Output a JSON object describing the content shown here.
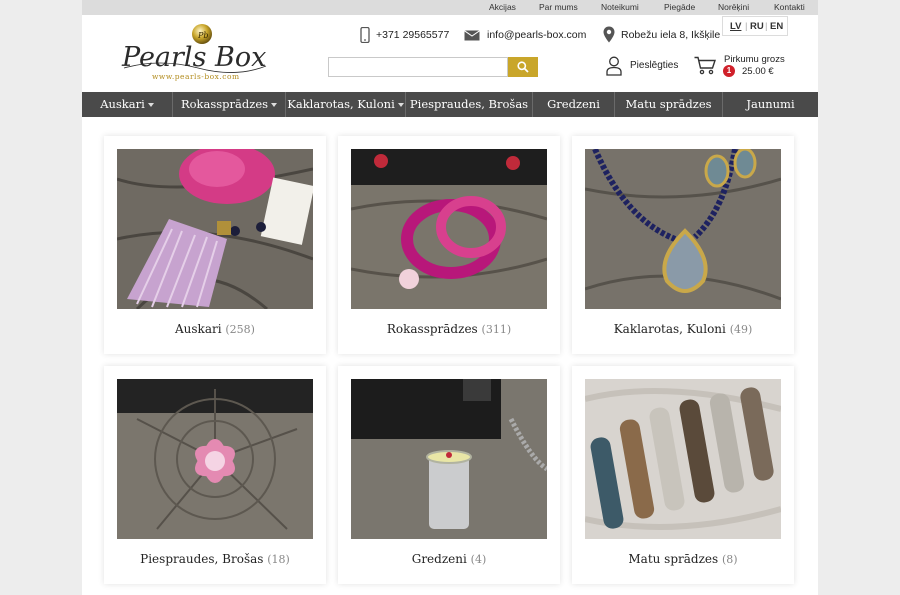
{
  "topbar": {
    "links": [
      "Akcijas",
      "Par mums",
      "Noteikumi",
      "Piegāde",
      "Norēķini",
      "Kontakti"
    ]
  },
  "logo": {
    "text": "Pearls Box",
    "url_text": "www.pearls-box.com"
  },
  "contact": {
    "phone": "+371 29565577",
    "email": "info@pearls-box.com",
    "address": "Robežu iela 8, Ikšķile"
  },
  "languages": [
    "LV",
    "RU",
    "EN"
  ],
  "active_language": "LV",
  "search": {
    "value": "",
    "placeholder": ""
  },
  "account": {
    "login_label": "Pieslēgties"
  },
  "cart": {
    "title": "Pirkumu grozs",
    "count": "1",
    "price": "25.00 €"
  },
  "nav": [
    {
      "label": "Auskari",
      "dropdown": true
    },
    {
      "label": "Rokassprādzes",
      "dropdown": true
    },
    {
      "label": "Kaklarotas, Kuloni",
      "dropdown": true
    },
    {
      "label": "Piespraudes, Brošas",
      "dropdown": false
    },
    {
      "label": "Gredzeni",
      "dropdown": false
    },
    {
      "label": "Matu sprādzes",
      "dropdown": false
    },
    {
      "label": "Jaunumi",
      "dropdown": false
    }
  ],
  "categories": [
    {
      "name": "Auskari",
      "count": "(258)"
    },
    {
      "name": "Rokassprādzes",
      "count": "(311)"
    },
    {
      "name": "Kaklarotas, Kuloni",
      "count": "(49)"
    },
    {
      "name": "Piespraudes, Brošas",
      "count": "(18)"
    },
    {
      "name": "Gredzeni",
      "count": "(4)"
    },
    {
      "name": "Matu sprādzes",
      "count": "(8)"
    }
  ],
  "colors": {
    "accent": "#c9a62a",
    "nav_bg": "#4a4a4a",
    "badge": "#d0202a",
    "topbar_bg": "#dcdcdc"
  }
}
